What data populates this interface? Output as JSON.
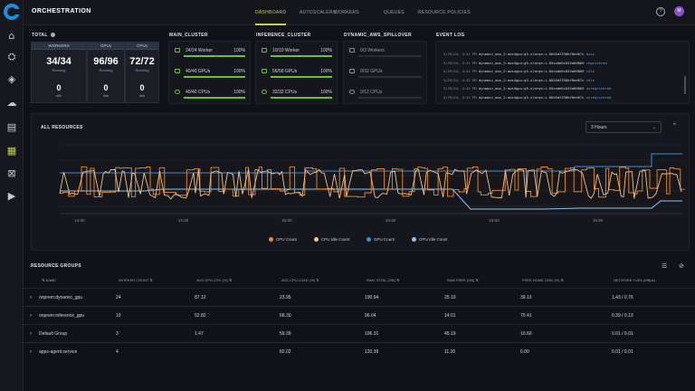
{
  "app": {
    "title": "ORCHESTRATION",
    "avatar_initial": "M",
    "help_glyph": "?"
  },
  "nav": {
    "tabs": [
      {
        "label": "DASHBOARD",
        "active": true
      },
      {
        "label": "AUTOSCALERS",
        "active": false
      },
      {
        "label": "WORKERS",
        "active": false
      },
      {
        "label": "QUEUES",
        "active": false
      },
      {
        "label": "RESOURCE POLICIES",
        "active": false
      }
    ]
  },
  "sidebar": {
    "icons": [
      "home-icon",
      "bus-icon",
      "layers-icon",
      "cloud-upload-icon",
      "document-icon",
      "grid-icon",
      "network-icon",
      "arrow-right-icon"
    ],
    "active_index": 5
  },
  "total": {
    "title": "TOTAL",
    "workers": {
      "header": "WORKERS",
      "value": "34/34",
      "label": "Running",
      "idle": "0",
      "idle_label": "Idle"
    },
    "gpus": {
      "header": "GPUs",
      "value": "96/96",
      "label": "Running",
      "idle": "0",
      "idle_label": "Idle"
    },
    "cpus": {
      "header": "CPUs",
      "value": "72/72",
      "label": "Running",
      "idle": "0",
      "idle_label": "Idle"
    }
  },
  "clusters": [
    {
      "title": "MAIN_CLUSTER",
      "rows": [
        {
          "label": "24/24 Worker",
          "pct": "100%",
          "fill": 1.0
        },
        {
          "label": "40/40 GPUs",
          "pct": "100%",
          "fill": 1.0
        },
        {
          "label": "40/40 CPUs",
          "pct": "100%",
          "fill": 1.0
        }
      ]
    },
    {
      "title": "INFERENCE_CLUSTER",
      "rows": [
        {
          "label": "10/10 Worker",
          "pct": "100%",
          "fill": 1.0
        },
        {
          "label": "56/56 GPUs",
          "pct": "100%",
          "fill": 1.0
        },
        {
          "label": "32/32 CPUs",
          "pct": "100%",
          "fill": 1.0
        }
      ]
    },
    {
      "title": "DYNAMIC_AWS_SPILLOVER",
      "rows": [
        {
          "label": "0/3 Workers",
          "pct": "",
          "fill": 0.0
        },
        {
          "label": "0/32 GPUs",
          "pct": "",
          "fill": 0.0
        },
        {
          "label": "0/12 CPUs",
          "pct": "",
          "fill": 0.0
        }
      ]
    }
  ],
  "event_log": {
    "title": "EVENT LOG",
    "entries": [
      {
        "time": "5/29/24, 4:41 PM",
        "text": "dynamic_aws_2:aws4gpu:g5.xlarge:i-0b26df358bf0ed67c",
        "state": "busy"
      },
      {
        "time": "5/29/24, 4:41 PM",
        "text": "dynamic_aws_2:aws4gpu:g5.xlarge:i-05cade0c045a608b9",
        "state": "registered"
      },
      {
        "time": "5/29/24, 4:41 PM",
        "text": "dynamic_aws_2:aws4gpu:g5.xlarge:i-05cade0c045a608b9",
        "state": "idle"
      },
      {
        "time": "5/29/24, 4:42 PM",
        "text": "dynamic_aws_2:aws4gpu:g5.xlarge:i-0b26df358bf0ed67c",
        "state": "idle"
      },
      {
        "time": "5/29/24, 4:42 PM",
        "text": "dynamic_aws_2:aws4gpu:g5.xlarge:i-05cade0c045a608b9",
        "state": "unregistered"
      },
      {
        "time": "5/29/24, 4:42 PM",
        "text": "dynamic_aws_2:aws4gpu:g5.xlarge:i-0b26df358bf0ed67c",
        "state": "unregistered"
      }
    ]
  },
  "all_resources": {
    "title": "ALL RESOURCES",
    "range_select": "3 Hours",
    "collapse_glyph": "^"
  },
  "chart_data": {
    "type": "line",
    "x_ticks": [
      "14:00",
      "14:30",
      "15:00",
      "15:30",
      "16:00",
      "16:30"
    ],
    "series": [
      {
        "name": "CPU Count",
        "color": "#f28c28"
      },
      {
        "name": "CPU Idle Count",
        "color": "#f5c48a"
      },
      {
        "name": "GPU Count",
        "color": "#3a8fe0"
      },
      {
        "name": "GPU Idle Count",
        "color": "#8cc4f5"
      }
    ],
    "grid": true
  },
  "resource_groups": {
    "title": "RESOURCE GROUPS",
    "columns": [
      "NAME",
      "WORKER COUNT",
      "AVG GPU UTIL (%)",
      "AVG CPU LOAD (%)",
      "RAM TOTAL (GB)",
      "RAM FREE (GB)",
      "FREE HOME DISK (%)",
      "NETWORK Tx/Rx (MBps)"
    ],
    "rows": [
      {
        "name": "onprem:dynamic_gpu",
        "workers": "24",
        "gpu": "87.12",
        "cpu": "23.95",
        "ram_total": "190.94",
        "ram_free": "25.10",
        "disk": "39.10",
        "net": "1.43 / 0.76"
      },
      {
        "name": "onprem:inference_gpu",
        "workers": "10",
        "gpu": "52.82",
        "cpu": "68.30",
        "ram_total": "96.04",
        "ram_free": "14.01",
        "disk": "70.41",
        "net": "0.39 / 0.13"
      },
      {
        "name": "Default Group",
        "workers": "3",
        "gpu": "1.47",
        "cpu": "59.39",
        "ram_total": "106.31",
        "ram_free": "45.19",
        "disk": "10.60",
        "net": "0.01 / 0.01"
      },
      {
        "name": "apps-agent:service",
        "workers": "4",
        "gpu": "",
        "cpu": "82.02",
        "ram_total": "120.39",
        "ram_free": "11.20",
        "disk": "0.00",
        "net": "0.01 / 0.01"
      }
    ]
  }
}
